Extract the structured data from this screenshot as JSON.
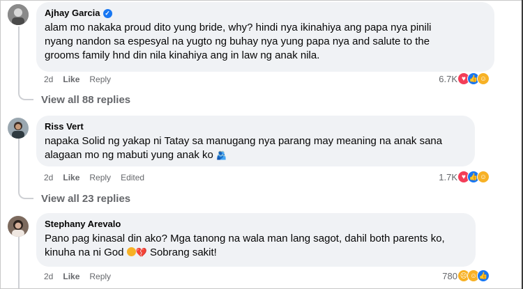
{
  "colors": {
    "accent": "#1877f2",
    "bubble": "#f0f2f5",
    "muted": "#65676b",
    "heart": "#f33e58",
    "care": "#f7b125"
  },
  "comments": [
    {
      "author": "Ajhay Garcia",
      "verified": true,
      "lines": [
        "alam mo nakaka proud dito yung bride, why? hindi nya ikinahiya ang papa nya pinili",
        "nyang nandon sa espesyal na yugto ng buhay nya yung papa nya and salute to the",
        "grooms family hnd din nila kinahiya ang in law ng anak nila."
      ],
      "time": "2d",
      "like": "Like",
      "reply": "Reply",
      "reaction_count": "6.7K",
      "reactions": [
        "heart-icon",
        "like-icon",
        "care-icon"
      ],
      "view_replies": "View all 88 replies"
    },
    {
      "author": "Riss Vert",
      "verified": false,
      "lines": [
        "napaka Solid ng yakap ni Tatay sa manugang nya parang may meaning na anak sana",
        "alagaan mo ng mabuti yung anak ko"
      ],
      "time": "2d",
      "like": "Like",
      "reply": "Reply",
      "edited": "Edited",
      "reaction_count": "1.7K",
      "reactions": [
        "heart-icon",
        "like-icon",
        "care-icon"
      ],
      "view_replies": "View all 23 replies"
    },
    {
      "author": "Stephany Arevalo",
      "verified": false,
      "lines": [
        "Pano pag kinasal din ako? Mga tanong na wala man lang sagot, dahil both parents ko,",
        "kinuha na ni God",
        "Sobrang sakit!"
      ],
      "time": "2d",
      "like": "Like",
      "reply": "Reply",
      "reaction_count": "780",
      "reactions": [
        "sad-icon",
        "care-icon",
        "like-icon"
      ]
    }
  ]
}
